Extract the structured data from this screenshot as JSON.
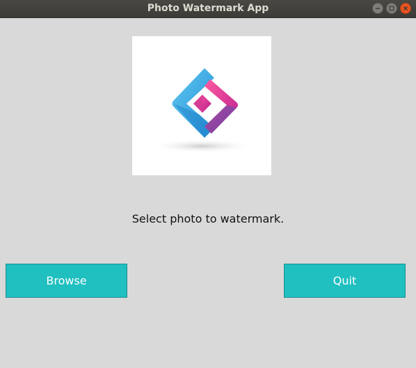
{
  "window": {
    "title": "Photo Watermark App",
    "controls": {
      "minimize": "minimize-icon",
      "maximize": "maximize-icon",
      "close": "close-icon"
    }
  },
  "main": {
    "logo": {
      "icon": "app-logo-diamond-icon"
    },
    "prompt": "Select photo to watermark.",
    "buttons": {
      "browse_label": "Browse",
      "quit_label": "Quit"
    }
  },
  "colors": {
    "button_bg": "#20bfc0",
    "window_bg": "#d9d9d9",
    "titlebar_bg": "#3c3b37",
    "close_button": "#e95420"
  }
}
